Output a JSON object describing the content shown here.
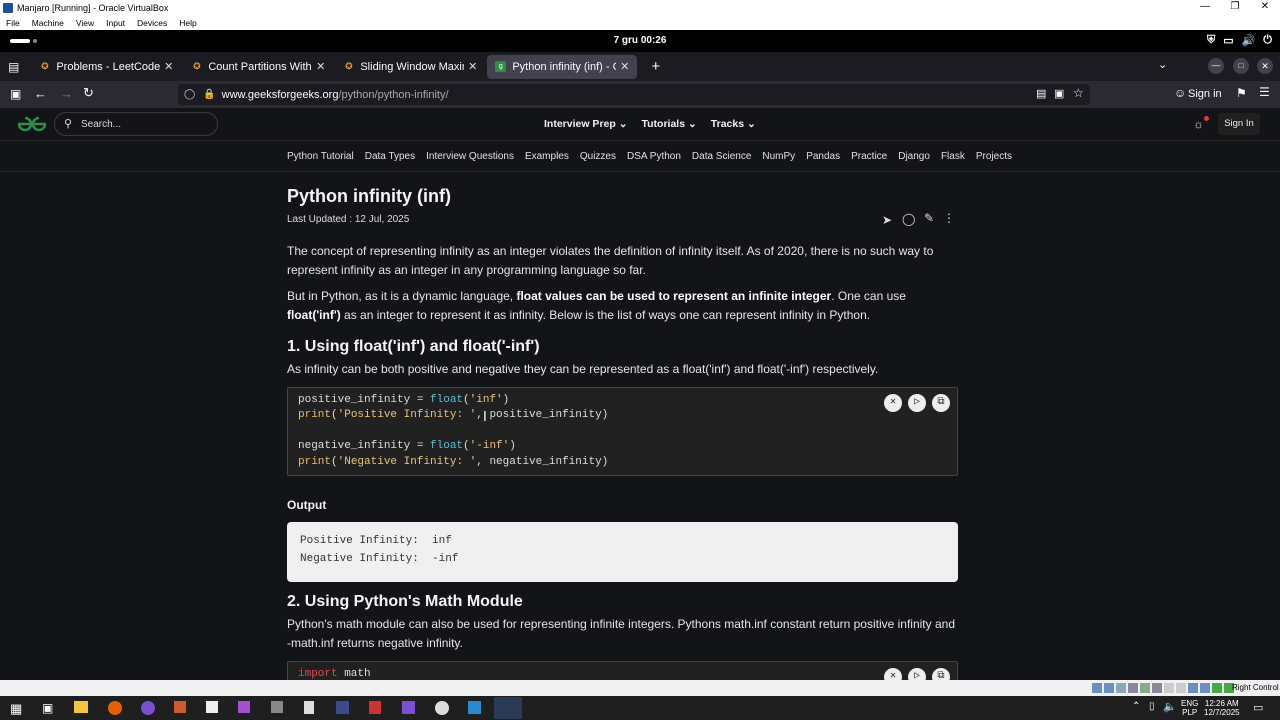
{
  "vbox": {
    "title": "Manjaro [Running] - Oracle VirtualBox",
    "menu": [
      "File",
      "Machine",
      "View",
      "Input",
      "Devices",
      "Help"
    ],
    "status_text": "Right Control"
  },
  "gnome": {
    "clock": "7 gru  00:26"
  },
  "tabs": [
    {
      "label": "Problems - LeetCode",
      "active": false
    },
    {
      "label": "Count Partitions With M",
      "active": false
    },
    {
      "label": "Sliding Window Maximu",
      "active": false
    },
    {
      "label": "Python infinity (inf) - Gee",
      "active": true
    }
  ],
  "navbar": {
    "url_host": "www.geeksforgeeks.org",
    "url_path": "/python/python-infinity/",
    "sign_in": "Sign in"
  },
  "gfg": {
    "search_placeholder": "Search...",
    "nav": [
      "Interview Prep",
      "Tutorials",
      "Tracks"
    ],
    "sign_in": "Sign In",
    "subnav": [
      "Python Tutorial",
      "Data Types",
      "Interview Questions",
      "Examples",
      "Quizzes",
      "DSA Python",
      "Data Science",
      "NumPy",
      "Pandas",
      "Practice",
      "Django",
      "Flask",
      "Projects"
    ]
  },
  "article": {
    "title": "Python infinity (inf)",
    "updated": "Last Updated : 12 Jul, 2025",
    "p1": "The concept of representing infinity as an integer violates the definition of infinity itself. As of 2020, there is no such way to represent infinity as an integer in any programming language so far.",
    "p2_a": "But in Python, as it is a dynamic language, ",
    "p2_b": "float values can be used to represent an infinite integer",
    "p2_c": ". One can use ",
    "p2_d": "float('inf')",
    "p2_e": " as an integer to represent it as infinity. Below is the list of ways one can represent infinity in Python.",
    "h2_1": "1. Using float('inf') and float('-inf')",
    "p3": "As infinity can be both positive and negative they can be represented as a float('inf') and float('-inf') respectively.",
    "code1": [
      "positive_infinity = float('inf')",
      "print('Positive Infinity: ', positive_infinity)",
      "",
      "negative_infinity = float('-inf')",
      "print('Negative Infinity: ', negative_infinity)"
    ],
    "output_label": "Output",
    "output": [
      "Positive Infinity:  inf",
      "Negative Infinity:  -inf"
    ],
    "h2_2": "2. Using Python's Math Module",
    "p4": "Python's math module can also be used for representing infinite integers. Pythons math.inf constant return positive infinity and -math.inf returns negative infinity.",
    "code2_kw": "import",
    "code2_rest": " math"
  },
  "taskbar": {
    "lang1": "ENG",
    "lang2": "PLP",
    "time": "12:26 AM",
    "date": "12/7/2025"
  }
}
